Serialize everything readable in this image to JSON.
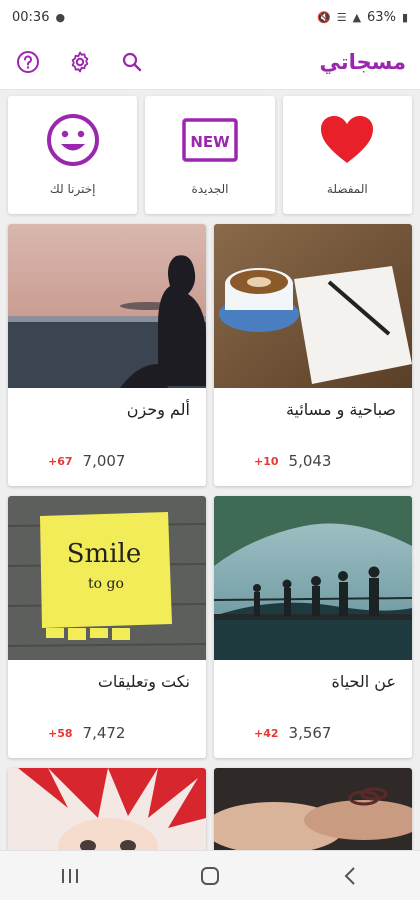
{
  "status": {
    "time": "00:36",
    "battery": "63%"
  },
  "appbar": {
    "title": "مسجاتي",
    "icons": [
      "help-icon",
      "settings-icon",
      "search-icon"
    ]
  },
  "categories": [
    {
      "label": "المفضلة",
      "icon": "heart-icon"
    },
    {
      "label": "الجديدة",
      "icon": "new-badge-icon"
    },
    {
      "label": "إخترنا لك",
      "icon": "smiley-icon"
    }
  ],
  "cards": [
    {
      "title": "صباحية و مسائية",
      "count": "5,043",
      "delta": "+10"
    },
    {
      "title": "ألم وحزن",
      "count": "7,007",
      "delta": "+67"
    },
    {
      "title": "عن الحياة",
      "count": "3,567",
      "delta": "+42"
    },
    {
      "title": "نكت وتعليقات",
      "count": "7,472",
      "delta": "+58",
      "note_text": "Smile",
      "note_sub": "to go"
    }
  ],
  "colors": {
    "accent": "#9b27af",
    "heart": "#e8202a",
    "delta": "#e53935"
  }
}
